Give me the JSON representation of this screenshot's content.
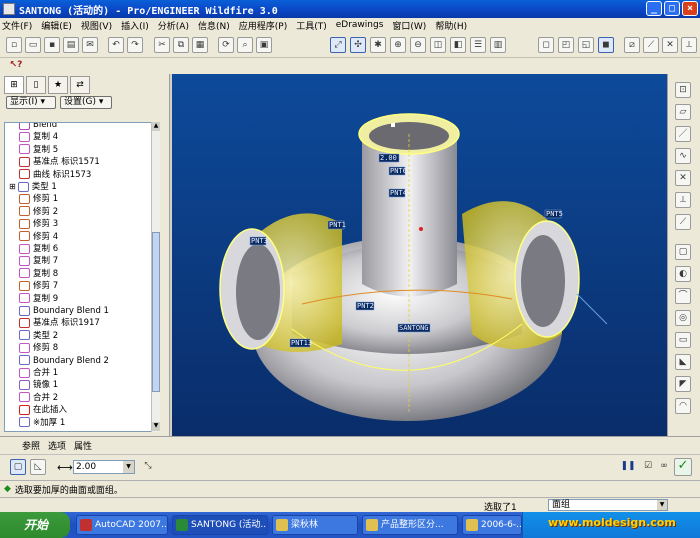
{
  "window": {
    "title": "SANTONG (活动的) - Pro/ENGINEER Wildfire 3.0",
    "buttons": [
      "_",
      "□",
      "×"
    ]
  },
  "menu": [
    "文件(F)",
    "编辑(E)",
    "视图(V)",
    "插入(I)",
    "分析(A)",
    "信息(N)",
    "应用程序(P)",
    "工具(T)",
    "eDrawings",
    "窗口(W)",
    "帮助(H)"
  ],
  "toolbar": {
    "icons": [
      "new-icon",
      "open-icon",
      "save-icon",
      "print-icon",
      "email-icon",
      "undo-icon",
      "redo-icon",
      "cut-icon",
      "copy-icon",
      "paste-icon",
      "regen-icon",
      "find-icon",
      "select-icon",
      "refit-icon",
      "zoom-in-icon",
      "zoom-out-icon",
      "repaint-icon",
      "spin-icon",
      "orient-icon",
      "saved-views-icon",
      "layers-icon",
      "wireframe-icon",
      "hidden-icon",
      "no-hidden-icon",
      "shading-icon",
      "datum-plane-icon",
      "datum-axis-icon",
      "datum-point-icon",
      "csys-icon"
    ]
  },
  "left_panel": {
    "show_label": "显示(I) ▾",
    "settings_label": "设置(G) ▾",
    "tree": [
      {
        "label": "Blend",
        "color": "#b048b0"
      },
      {
        "label": "复制 4",
        "color": "#c058c0"
      },
      {
        "label": "复制 5",
        "color": "#c058c0"
      },
      {
        "label": "基准点 标识1571",
        "color": "#c03030"
      },
      {
        "label": "曲线 标识1573",
        "color": "#c03030"
      },
      {
        "label": "类型 1",
        "color": "#6a6ac0"
      },
      {
        "label": "修剪 1",
        "color": "#c06030"
      },
      {
        "label": "修剪 2",
        "color": "#c06030"
      },
      {
        "label": "修剪 3",
        "color": "#c06030"
      },
      {
        "label": "修剪 4",
        "color": "#c06030"
      },
      {
        "label": "复制 6",
        "color": "#c058c0"
      },
      {
        "label": "复制 7",
        "color": "#c058c0"
      },
      {
        "label": "复制 8",
        "color": "#c058c0"
      },
      {
        "label": "修剪 7",
        "color": "#c06030"
      },
      {
        "label": "复制 9",
        "color": "#c058c0"
      },
      {
        "label": "Boundary Blend 1",
        "color": "#6a6ac0"
      },
      {
        "label": "基准点 标识1917",
        "color": "#c03030"
      },
      {
        "label": "类型 2",
        "color": "#6a6ac0"
      },
      {
        "label": "修剪 8",
        "color": "#c058c0"
      },
      {
        "label": "Boundary Blend 2",
        "color": "#6a6ac0"
      },
      {
        "label": "合并 1",
        "color": "#c058c0"
      },
      {
        "label": "镜像 1",
        "color": "#8a60c0"
      },
      {
        "label": "合并 2",
        "color": "#c058c0"
      },
      {
        "label": "在此插入",
        "color": "#d02020"
      },
      {
        "label": "※加厚 1",
        "color": "#6a6ac0"
      }
    ]
  },
  "viewport": {
    "labels": [
      "PNT6",
      "PNT4",
      "PNT1",
      "PNT5",
      "PNT3",
      "PNT2",
      "PNT13",
      "SANTONG",
      "2.00"
    ]
  },
  "dash_tabs": [
    "参照",
    "选项",
    "属性"
  ],
  "dashboard": {
    "thickness_value": "2.00"
  },
  "message": "选取要加厚的曲面或面组。",
  "status": {
    "selected": "选取了1",
    "filter": "面组"
  },
  "taskbar": {
    "start": "开始",
    "tasks": [
      "AutoCAD 2007...",
      "SANTONG (活动...",
      "梁秋林",
      "产品整形区分...",
      "2006-6-..."
    ],
    "watermark": "www.moldesign.com"
  }
}
